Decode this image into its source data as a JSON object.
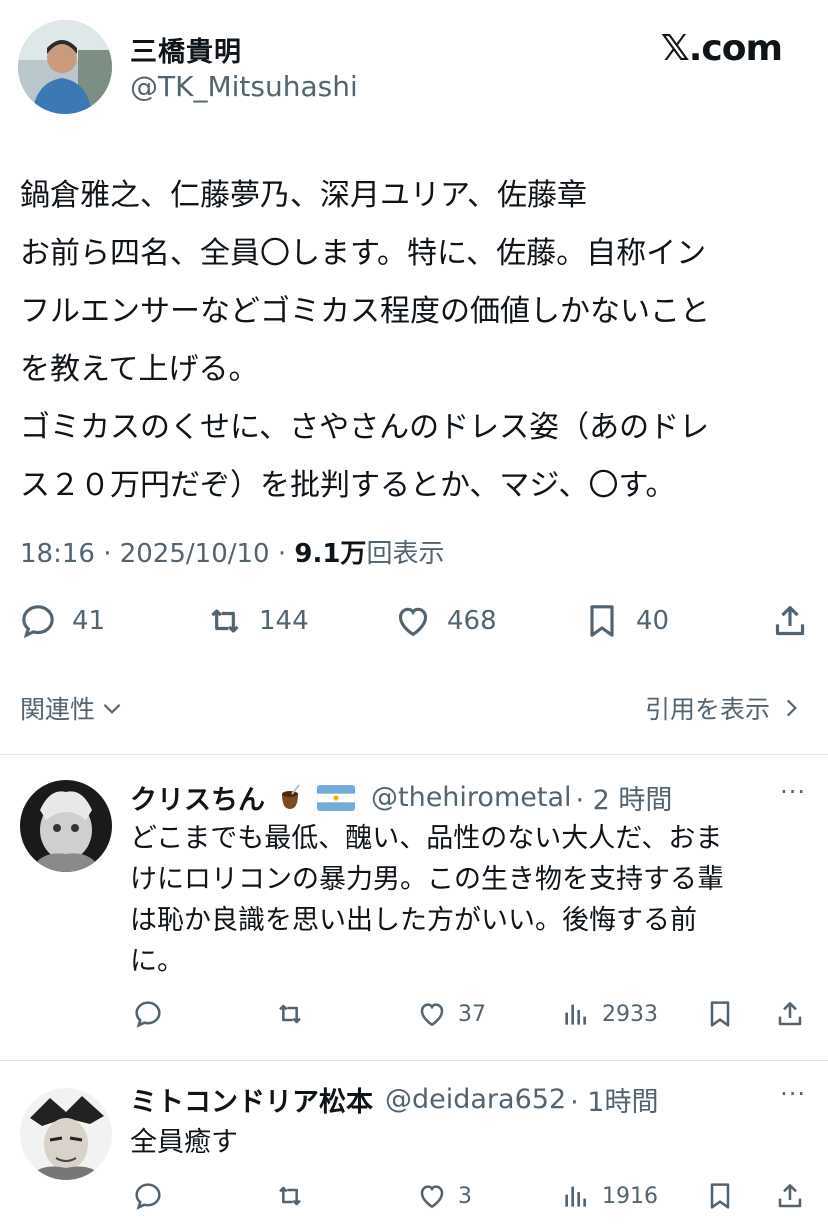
{
  "brand": "𝕏.com",
  "author": {
    "name": "三橋貴明",
    "handle": "@TK_Mitsuhashi"
  },
  "post": {
    "lines": [
      "鍋倉雅之、仁藤夢乃、深月ユリア、佐藤章",
      "お前ら四名、全員〇します。特に、佐藤。自称イン",
      "フルエンサーなどゴミカス程度の価値しかないこと",
      "を教えて上げる。",
      "ゴミカスのくせに、さやさんのドレス姿（あのドレ",
      "ス２０万円だぞ）を批判するとか、マジ、〇す。"
    ],
    "meta_prefix": "18:16 · 2025/10/10 · ",
    "views": "9.1万",
    "views_label": "回表示",
    "replies": "41",
    "reposts": "144",
    "likes": "468",
    "bookmarks": "40"
  },
  "related_label": "関連性",
  "quotes_label": "引用を表示",
  "replies": [
    {
      "name": "クリスちん",
      "handle": "@thehirometal",
      "time": "· 2 時間",
      "more": "···",
      "lines": [
        "どこまでも最低、醜い、品性のない大人だ、おま",
        "けにロリコンの暴力男。この生き物を支持する輩",
        "は恥か良識を思い出した方がいい。後悔する前",
        "に。"
      ],
      "likes": "37",
      "views": "2933"
    },
    {
      "name": "ミトコンドリア松本",
      "handle": "@deidara652",
      "time": "· 1時間",
      "more": "···",
      "lines": [
        "全員癒す"
      ],
      "likes": "3",
      "views": "1916"
    }
  ],
  "colors": {
    "text": "#0f1419",
    "secondary": "#536471",
    "divider": "#dde3e7"
  }
}
